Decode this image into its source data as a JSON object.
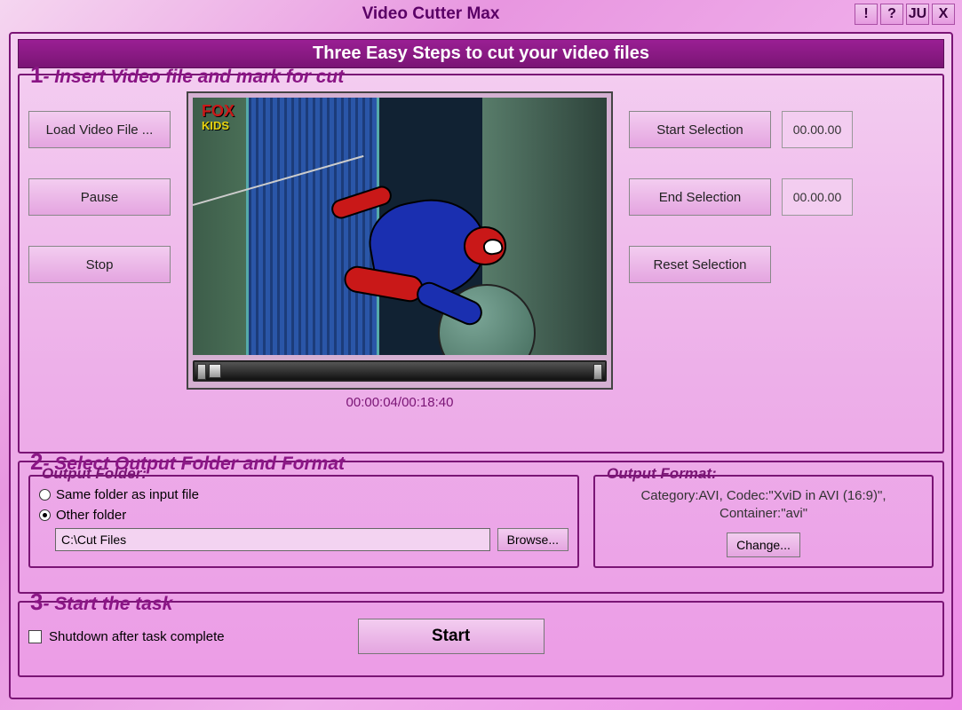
{
  "title": "Video Cutter Max",
  "titlebar_buttons": {
    "alert": "!",
    "help": "?",
    "extra": "JU",
    "close": "X"
  },
  "banner": "Three Easy Steps to cut your video files",
  "step1": {
    "num": "1",
    "legend": "- Insert Video file and mark for cut",
    "load_btn": "Load Video File ...",
    "pause_btn": "Pause",
    "stop_btn": "Stop",
    "start_sel_btn": "Start Selection",
    "end_sel_btn": "End Selection",
    "reset_sel_btn": "Reset Selection",
    "start_time": "00.00.00",
    "end_time": "00.00.00",
    "time_label": "00:00:04/00:18:40",
    "logo_top": "FOX",
    "logo_bottom": "KIDS"
  },
  "step2": {
    "num": "2",
    "legend": "- Select Output Folder and Format",
    "folder_legend": "Output Folder:",
    "radio_same": "Same folder as input file",
    "radio_other": "Other folder",
    "path_value": "C:\\Cut Files",
    "browse_btn": "Browse...",
    "format_legend": "Output Format:",
    "format_text": "Category:AVI, Codec:\"XviD in AVI (16:9)\", Container:\"avi\"",
    "change_btn": "Change..."
  },
  "step3": {
    "num": "3",
    "legend": "- Start the task",
    "shutdown_label": "Shutdown after task complete",
    "start_btn": "Start"
  }
}
